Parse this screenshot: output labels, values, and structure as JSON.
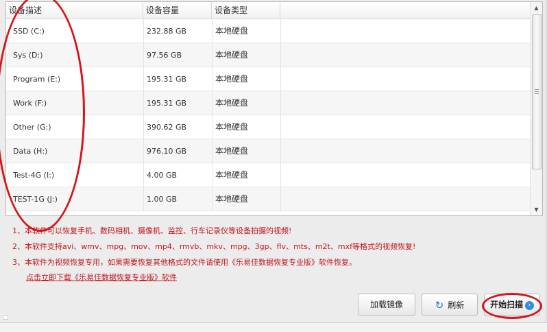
{
  "table": {
    "headers": [
      "设备描述",
      "设备容量",
      "设备类型"
    ],
    "rows": [
      {
        "desc": "SSD (C:)",
        "size": "232.88 GB",
        "type": "本地硬盘"
      },
      {
        "desc": "Sys (D:)",
        "size": "97.56 GB",
        "type": "本地硬盘"
      },
      {
        "desc": "Program (E:)",
        "size": "195.31 GB",
        "type": "本地硬盘"
      },
      {
        "desc": "Work (F:)",
        "size": "195.31 GB",
        "type": "本地硬盘"
      },
      {
        "desc": "Other (G:)",
        "size": "390.62 GB",
        "type": "本地硬盘"
      },
      {
        "desc": "Data (H:)",
        "size": "976.10 GB",
        "type": "本地硬盘"
      },
      {
        "desc": "Test-4G (I:)",
        "size": "4.00 GB",
        "type": "本地硬盘"
      },
      {
        "desc": "TEST-1G (J:)",
        "size": "1.00 GB",
        "type": "本地硬盘"
      }
    ]
  },
  "notes": [
    "1、本软件可以恢复手机、数码相机、摄像机、监控、行车记录仪等设备拍摄的视频!",
    "2、本软件支持avi、wmv、mpg、mov、mp4、rmvb、mkv、mpg、3gp、flv、mts、m2t、mxf等格式的视频恢复!",
    "3、本软件为视频恢复专用，如果需要恢复其他格式的文件请使用《乐易佳数据恢复专业版》软件恢复。"
  ],
  "download_link": "点击立即下载《乐易佳数据恢复专业版》软件",
  "buttons": {
    "load_image": "加载镜像",
    "refresh": "刷新",
    "start_scan": "开始扫描"
  },
  "icons": {
    "refresh": "refresh-icon",
    "start_scan": "arrow-right-circle-icon",
    "scroll_up": "chevron-up-icon",
    "scroll_down": "chevron-down-icon"
  },
  "colors": {
    "note_text": "#c0141b",
    "annotation": "#d4151c",
    "accent": "#2f8de2"
  }
}
